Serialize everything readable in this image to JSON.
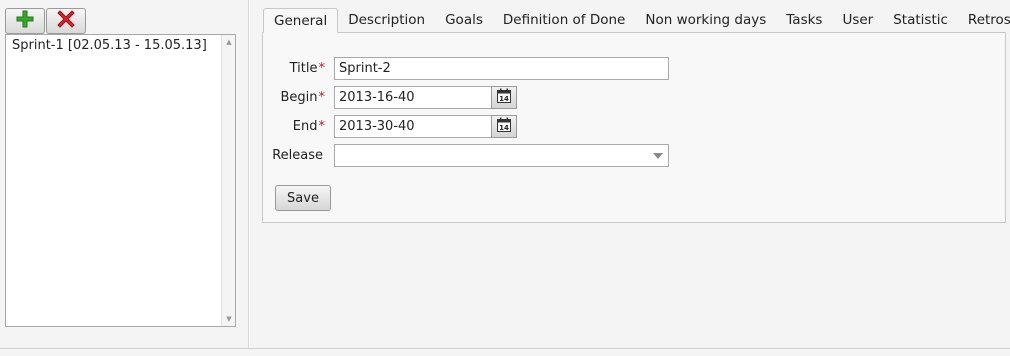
{
  "sprints": {
    "items": [
      {
        "label": "Sprint-1 [02.05.13 - 15.05.13]"
      }
    ]
  },
  "toolbar": {
    "add_icon": "plus-icon",
    "delete_icon": "x-icon",
    "add_color": "#3aa52d",
    "delete_color": "#d8262b"
  },
  "tabs": [
    {
      "label": "General",
      "active": true
    },
    {
      "label": "Description"
    },
    {
      "label": "Goals"
    },
    {
      "label": "Definition of Done"
    },
    {
      "label": "Non working days"
    },
    {
      "label": "Tasks"
    },
    {
      "label": "User"
    },
    {
      "label": "Statistic"
    },
    {
      "label": "Retrospective"
    }
  ],
  "form": {
    "title": {
      "label": "Title",
      "required_mark": "*",
      "value": "Sprint-2"
    },
    "begin": {
      "label": "Begin",
      "required_mark": "*",
      "value": "2013-16-40"
    },
    "end": {
      "label": "End",
      "required_mark": "*",
      "value": "2013-30-40"
    },
    "release": {
      "label": "Release",
      "value": ""
    },
    "calendar_icon_number": "14",
    "save_label": "Save"
  }
}
